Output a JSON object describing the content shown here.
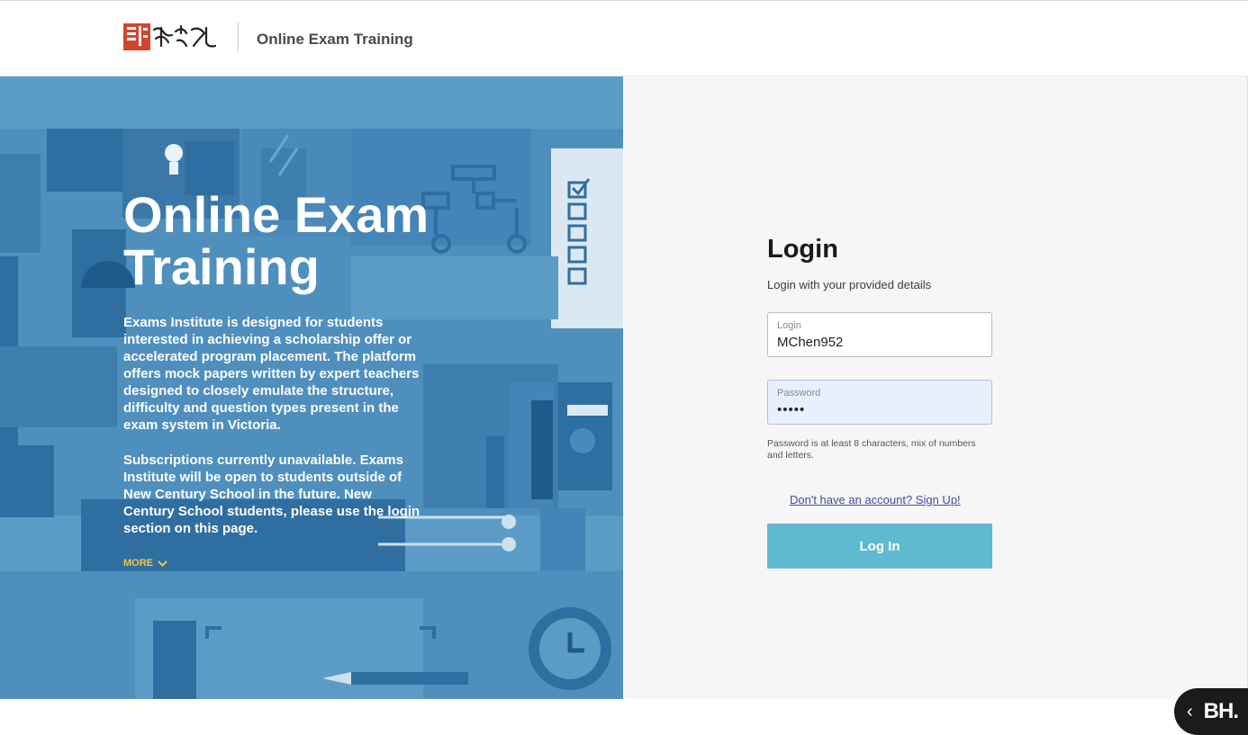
{
  "header": {
    "title": "Online Exam Training",
    "logo_text": "新世纪"
  },
  "hero": {
    "title": "Online Exam Training",
    "paragraph_1": "Exams Institute is designed for students interested in achieving a scholarship offer or accelerated program placement. The platform offers mock papers written by expert teachers designed to closely emulate the structure, difficulty and question types present in the exam system in Victoria.",
    "paragraph_2": "Subscriptions currently unavailable. Exams Institute will be open to students outside of New Century School in the future. New Century School students, please use the login section on this page.",
    "more_label": "MORE"
  },
  "login": {
    "title": "Login",
    "subtitle": "Login with your provided details",
    "login_label": "Login",
    "login_value": "MChen952",
    "password_label": "Password",
    "password_value": "•••••",
    "password_hint": "Password is at least 8 characters, mix of numbers and letters.",
    "signup_link": "Don't have an account? Sign Up!",
    "submit_label": "Log In"
  },
  "badge": {
    "text": "BH."
  },
  "colors": {
    "hero_bg": "#5b9cc7",
    "button": "#5fbad0",
    "more": "#f3c44a"
  }
}
